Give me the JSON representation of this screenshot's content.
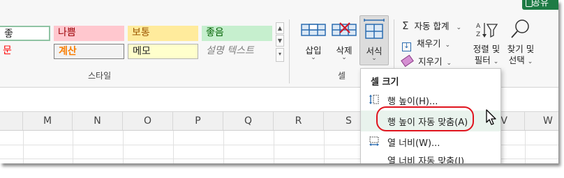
{
  "share_label": "공유",
  "styles": {
    "row1": [
      {
        "label": "좋",
        "bg": "#ffffff",
        "color": "#222222",
        "border": "#8fc3a3"
      },
      {
        "label": "나쁨",
        "bg": "#ffc7ce",
        "color": "#9c0006",
        "border": "#ffc7ce"
      },
      {
        "label": "보통",
        "bg": "#ffeb9c",
        "color": "#9c5700",
        "border": "#ffeb9c"
      },
      {
        "label": "좋음",
        "bg": "#c6efce",
        "color": "#006100",
        "border": "#c6efce"
      }
    ],
    "row2": [
      {
        "label": "문",
        "bg": "#f7f7f7",
        "color": "#ff0000",
        "border": "#f7f7f7"
      },
      {
        "label": "계산",
        "bg": "#f2f2f2",
        "color": "#fa7d00",
        "border": "#7f7f7f"
      },
      {
        "label": "메모",
        "bg": "#ffffcc",
        "color": "#222222",
        "border": "#b2b2b2"
      },
      {
        "label": "설명 텍스트",
        "bg": "#f7f7f7",
        "color": "#7f7f7f",
        "border": "#f7f7f7"
      }
    ],
    "group_label": "스타일"
  },
  "cells": {
    "insert_label": "삽입",
    "delete_label": "삭제",
    "format_label": "서식",
    "group_label": "셀"
  },
  "editing": {
    "autosum_label": "자동 합계",
    "fill_label": "채우기",
    "clear_label": "지우기",
    "sort_label_1": "정렬 및",
    "sort_label_2": "필터",
    "find_label_1": "찾기 및",
    "find_label_2": "선택"
  },
  "columns": [
    "M",
    "N",
    "O",
    "P",
    "Q",
    "R",
    "S",
    "T",
    "U",
    "V",
    "W"
  ],
  "menu": {
    "title": "셀 크기",
    "items": [
      {
        "label": "행 높이(H)..."
      },
      {
        "label": "행 높이 자동 맞춤(A)"
      },
      {
        "label": "열 너비(W)..."
      },
      {
        "label": "열 너비 자동 맞춤(I)"
      }
    ]
  },
  "colors": {
    "accent_green": "#1e7b45",
    "highlight_circle": "#e0141e",
    "icon_blue": "#2b6cb0"
  }
}
